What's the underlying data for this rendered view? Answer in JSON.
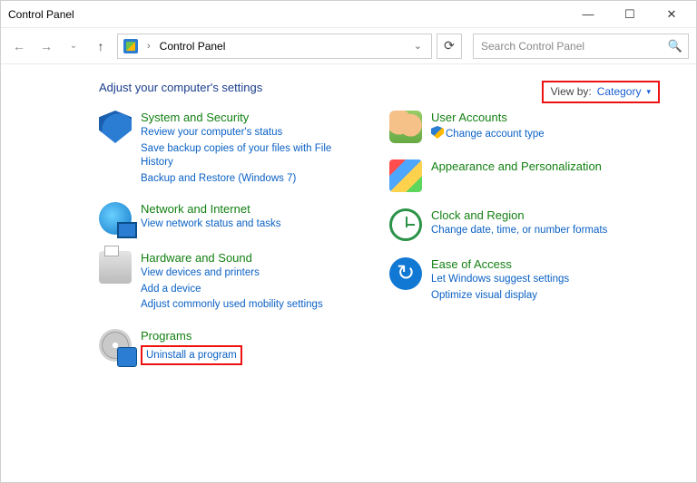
{
  "window": {
    "title": "Control Panel"
  },
  "address": {
    "text": "Control Panel"
  },
  "search": {
    "placeholder": "Search Control Panel"
  },
  "heading": "Adjust your computer's settings",
  "viewby": {
    "label": "View by:",
    "value": "Category"
  },
  "left": [
    {
      "icon": "shield-icon",
      "title": "System and Security",
      "links": [
        "Review your computer's status",
        "Save backup copies of your files with File History",
        "Backup and Restore (Windows 7)"
      ]
    },
    {
      "icon": "globe-icon",
      "title": "Network and Internet",
      "links": [
        "View network status and tasks"
      ]
    },
    {
      "icon": "printer-icon",
      "title": "Hardware and Sound",
      "links": [
        "View devices and printers",
        "Add a device",
        "Adjust commonly used mobility settings"
      ]
    },
    {
      "icon": "disc-icon",
      "title": "Programs",
      "links": [
        "Uninstall a program"
      ],
      "highlight": true
    }
  ],
  "right": [
    {
      "icon": "users-icon",
      "title": "User Accounts",
      "links": [
        "Change account type"
      ],
      "shield_on_first": true
    },
    {
      "icon": "appearance-icon",
      "title": "Appearance and Personalization",
      "links": []
    },
    {
      "icon": "clock-icon",
      "title": "Clock and Region",
      "links": [
        "Change date, time, or number formats"
      ]
    },
    {
      "icon": "ease-icon",
      "title": "Ease of Access",
      "links": [
        "Let Windows suggest settings",
        "Optimize visual display"
      ]
    }
  ]
}
